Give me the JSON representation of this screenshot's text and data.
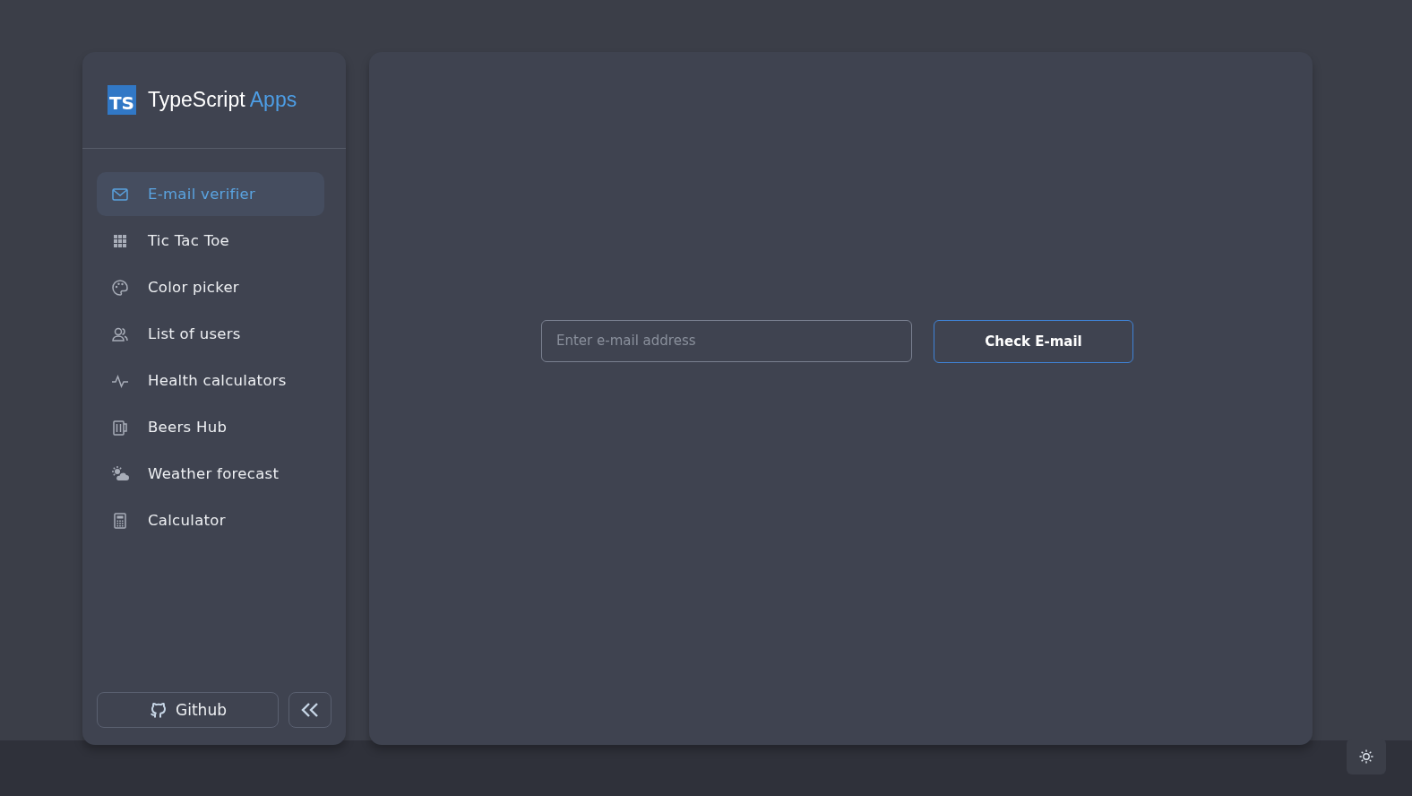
{
  "brand": {
    "badge": "TS",
    "name": "TypeScript",
    "accent": "Apps"
  },
  "nav": [
    {
      "label": "E-mail verifier",
      "selected": true
    },
    {
      "label": "Tic Tac Toe",
      "selected": false
    },
    {
      "label": "Color picker",
      "selected": false
    },
    {
      "label": "List of users",
      "selected": false
    },
    {
      "label": "Health calculators",
      "selected": false
    },
    {
      "label": "Beers Hub",
      "selected": false
    },
    {
      "label": "Weather forecast",
      "selected": false
    },
    {
      "label": "Calculator",
      "selected": false
    }
  ],
  "github_button": "Github",
  "email_form": {
    "placeholder": "Enter e-mail address",
    "button": "Check E-mail"
  }
}
